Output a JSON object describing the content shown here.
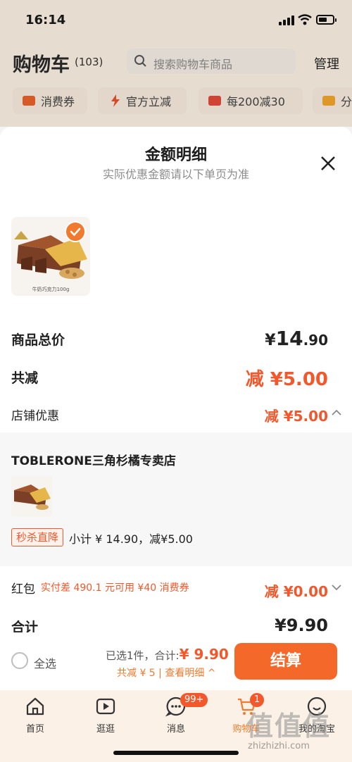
{
  "status_bar": {
    "time": "16:14"
  },
  "header": {
    "title": "购物车",
    "count": "(103)",
    "search_placeholder": "搜索购物车商品",
    "manage": "管理"
  },
  "chips": [
    {
      "icon": "coupon-icon",
      "label": "消费券"
    },
    {
      "icon": "lightning-icon",
      "label": "官方立减"
    },
    {
      "icon": "gift-icon",
      "label": "每200减30"
    },
    {
      "icon": "folder-icon",
      "label": "分"
    }
  ],
  "sheet": {
    "title": "金额明细",
    "subtitle": "实际优惠金额请以下单页为准",
    "product_caption": "牛奶巧克力100g",
    "total_label": "商品总价",
    "total_currency": "¥",
    "total_int": "14",
    "total_dec": ".90",
    "discount_label": "共减",
    "discount_value": "减 ¥5.00",
    "shop_discount_label": "店铺优惠",
    "shop_discount_value": "减 ¥5.00",
    "shop_name": "TOBLERONE三角杉橘专卖店",
    "flash_tag": "秒杀直降",
    "subtotal": "小计 ¥ 14.90，减¥5.00",
    "redpacket_label": "红包",
    "redpacket_note": "实付差 490.1 元可用 ¥40 消费券",
    "redpacket_value": "减 ¥0.00",
    "sum_label": "合计",
    "sum_value": "¥9.90"
  },
  "bottom_bar": {
    "select_all": "全选",
    "selected_text": "已选1件，合计:",
    "selected_total": "¥ 9.90",
    "detail_link": "共减 ¥ 5 | 查看明细 ^",
    "checkout": "结算"
  },
  "tabs": [
    {
      "label": "首页",
      "icon": "home-icon"
    },
    {
      "label": "逛逛",
      "icon": "play-icon"
    },
    {
      "label": "消息",
      "icon": "message-icon",
      "badge": "99+"
    },
    {
      "label": "购物车",
      "icon": "cart-icon",
      "badge": "1"
    },
    {
      "label": "我的淘宝",
      "icon": "profile-icon"
    }
  ],
  "watermark": {
    "text": "值值值",
    "url": "zhizhizhi.com"
  },
  "colors": {
    "accent": "#f4692a",
    "price_red": "#f2582b",
    "tabbar_bg": "#fbf1e6"
  }
}
